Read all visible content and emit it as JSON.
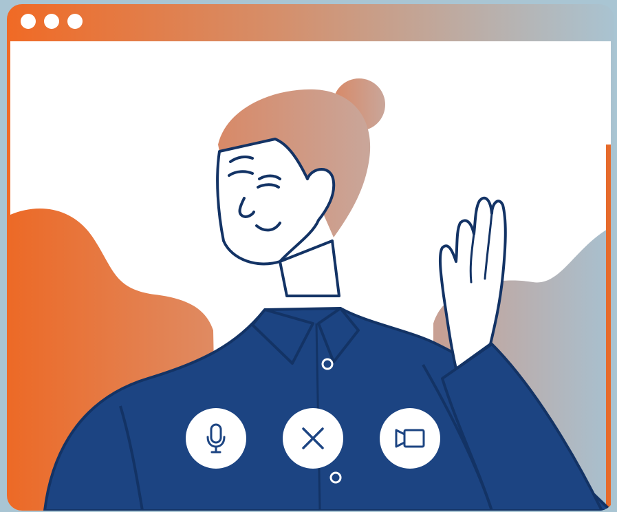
{
  "window": {
    "dots": [
      "close-dot",
      "minimize-dot",
      "maximize-dot"
    ]
  },
  "controls": {
    "microphone": {
      "icon": "microphone-icon"
    },
    "end_call": {
      "icon": "close-icon"
    },
    "camera": {
      "icon": "video-camera-icon"
    }
  },
  "colors": {
    "frame_gradient_start": "#f06a25",
    "frame_gradient_end": "#a9c3d1",
    "shirt": "#1c4482",
    "outline": "#133365",
    "hair": "#d79a7f",
    "background_blob_orange": "#e56f35",
    "background_blob_blue": "#a7bfd0"
  }
}
